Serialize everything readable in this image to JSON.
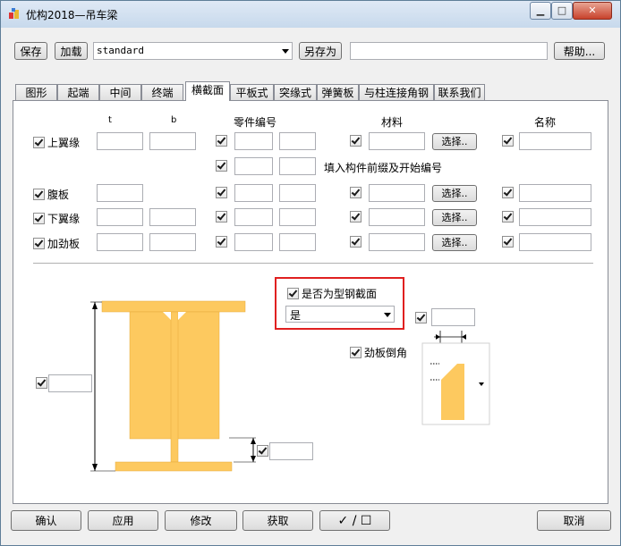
{
  "window": {
    "title": "优构2018—吊车梁"
  },
  "toolbar": {
    "save_label": "保存",
    "load_label": "加载",
    "preset_value": "standard",
    "save_as_label": "另存为",
    "save_as_value": "",
    "help_label": "帮助..."
  },
  "tabs": [
    "图形",
    "起端",
    "中间",
    "终端",
    "横截面",
    "平板式",
    "突缘式",
    "弹簧板",
    "与柱连接角钢",
    "联系我们"
  ],
  "active_tab": "横截面",
  "headers": {
    "t": "t",
    "b": "b",
    "part_no": "零件编号",
    "material": "材料",
    "name": "名称"
  },
  "rows": {
    "top_flange": "上翼缘",
    "web": "腹板",
    "bottom_flange": "下翼缘",
    "stiffener": "加劲板"
  },
  "prefix_label": "填入构件前缀及开始编号",
  "select_label": "选择..",
  "section": {
    "is_profile_label": "是否为型钢截面",
    "is_profile_value": "是",
    "chamfer_label": "劲板倒角"
  },
  "bottom": {
    "ok": "确认",
    "apply": "应用",
    "modify": "修改",
    "get": "获取",
    "toggle": "✓ / ☐",
    "cancel": "取消"
  },
  "colors": {
    "steel": "#fdc95f",
    "highlight": "#e02020"
  }
}
